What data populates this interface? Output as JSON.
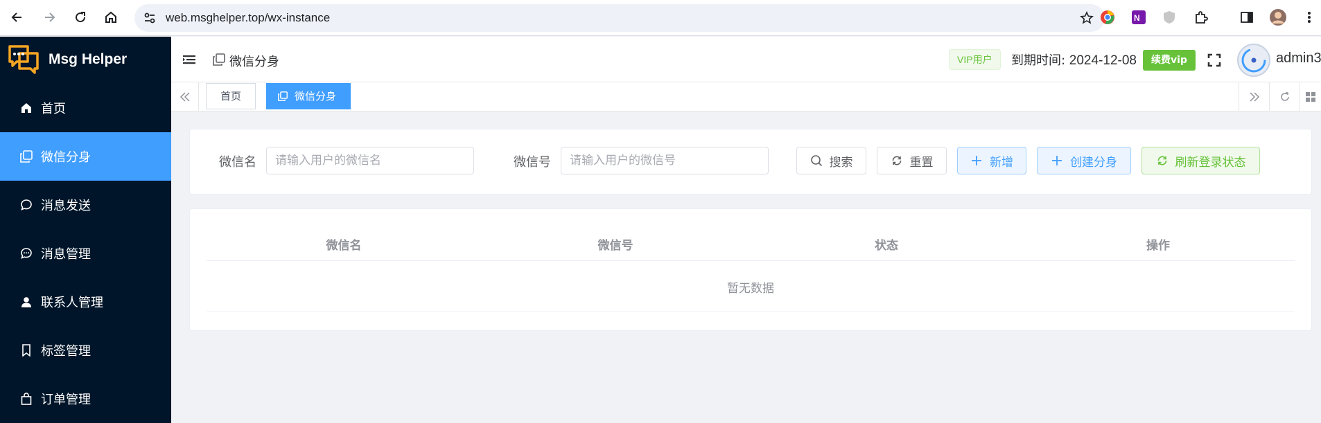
{
  "browser": {
    "url": "web.msghelper.top/wx-instance"
  },
  "app": {
    "name": "Msg Helper"
  },
  "sidebar": {
    "items": [
      {
        "label": "首页",
        "icon": "home-icon"
      },
      {
        "label": "微信分身",
        "icon": "copy-icon",
        "active": true
      },
      {
        "label": "消息发送",
        "icon": "chat-bubble-icon"
      },
      {
        "label": "消息管理",
        "icon": "chat-dots-icon"
      },
      {
        "label": "联系人管理",
        "icon": "user-icon"
      },
      {
        "label": "标签管理",
        "icon": "bookmark-icon"
      },
      {
        "label": "订单管理",
        "icon": "shopping-bag-icon"
      }
    ]
  },
  "header": {
    "breadcrumb": "微信分身",
    "vip_tag": "VIP用户",
    "expire_label": "到期时间: ",
    "expire_date": "2024-12-08",
    "renew_button": "续费vip",
    "username": "admin3"
  },
  "tags": {
    "items": [
      {
        "label": "首页",
        "active": false
      },
      {
        "label": "微信分身",
        "active": true
      }
    ]
  },
  "search": {
    "wechat_name_label": "微信名",
    "wechat_name_placeholder": "请输入用户的微信名",
    "wechat_name_value": "",
    "wechat_id_label": "微信号",
    "wechat_id_placeholder": "请输入用户的微信号",
    "wechat_id_value": "",
    "search_button": "搜索",
    "reset_button": "重置",
    "add_button": "新增",
    "create_instance_button": "创建分身",
    "refresh_login_button": "刷新登录状态"
  },
  "table": {
    "columns": [
      "微信名",
      "微信号",
      "状态",
      "操作"
    ],
    "rows": [],
    "empty_text": "暂无数据"
  },
  "colors": {
    "sidebar_bg": "#001529",
    "primary": "#409eff",
    "success": "#67c23a"
  }
}
